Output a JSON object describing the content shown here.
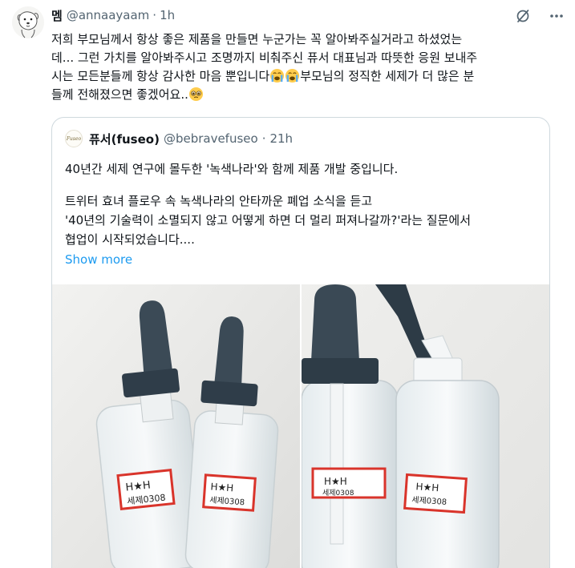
{
  "tweet": {
    "display_name": "멤",
    "handle": "@annaayaam",
    "dot": "·",
    "time": "1h",
    "lines": [
      "저희 부모님께서 항상 좋은 제품을 만들면 누군가는 꼭 알아봐주실거라고 하셨었는",
      "데... 그런 가치를 알아봐주시고 조명까지 비춰주신 퓨서 대표님과 따뜻한 응원 보내주",
      "시는 모든분들께 항상 감사한 마음 뿐입니다",
      "부모님의 정직한 세제가 더 많은 분",
      "들께 전해졌으면 좋겠어요.."
    ],
    "emojis": [
      "loudly-crying-face",
      "loudly-crying-face",
      "pleading-face"
    ]
  },
  "quote": {
    "logo_text": "Fuseo",
    "display_name": "퓨서(fuseo)",
    "handle": "@bebravefuseo",
    "dot": "·",
    "time": "21h",
    "lines": [
      "40년간 세제 연구에 몰두한 '녹색나라'와 함께 제품 개발 중입니다.",
      "트위터 효녀 플로우 속 녹색나라의 안타까운 폐업 소식을 듣고",
      "'40년의 기술력이 소멸되지 않고 어떻게 하면 더 멀리 퍼져나갈까?'라는 질문에서",
      "협업이 시작되었습니다...."
    ],
    "show_more": "Show more"
  },
  "photos": [
    {
      "label_line1": "H★H",
      "label_line2": "세제0308"
    },
    {
      "label_line1": "H★H",
      "label_line2": "세제0308"
    }
  ],
  "colors": {
    "link": "#1d9bf0",
    "secondary_text": "#536471",
    "border": "#cfd9de"
  },
  "icons": [
    "grok-icon",
    "more-icon"
  ]
}
